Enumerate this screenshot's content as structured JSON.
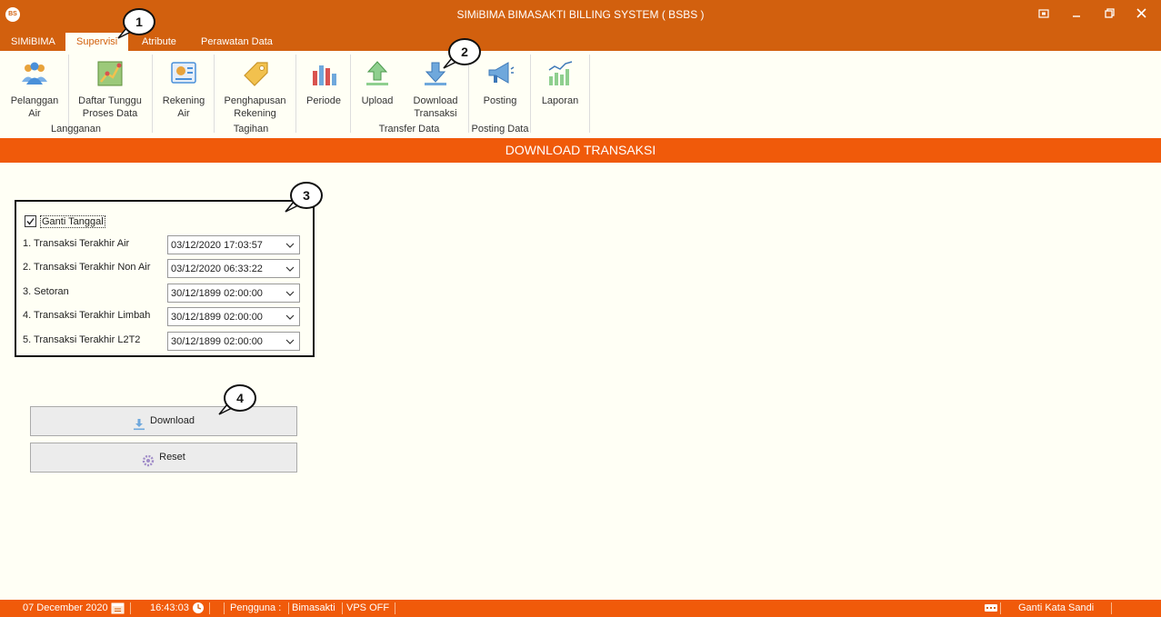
{
  "window": {
    "title": "SIMiBIMA BIMASAKTI BILLING SYSTEM ( BSBS )",
    "app_icon_text": "BS"
  },
  "tabs": [
    "SIMiBIMA",
    "Supervisi",
    "Atribute",
    "Perawatan Data"
  ],
  "ribbon": {
    "buttons": [
      {
        "label": "Pelanggan\nAir",
        "icon": "users-icon"
      },
      {
        "label": "Daftar Tunggu\nProses Data",
        "icon": "map-icon"
      },
      {
        "label": "Rekening\nAir",
        "icon": "bill-icon"
      },
      {
        "label": "Penghapusan\nRekening",
        "icon": "tag-icon"
      },
      {
        "label": "Periode",
        "icon": "bar-chart-icon"
      },
      {
        "label": "Upload",
        "icon": "upload-icon"
      },
      {
        "label": "Download\nTransaksi",
        "icon": "download-icon"
      },
      {
        "label": "Posting",
        "icon": "megaphone-icon"
      },
      {
        "label": "Laporan",
        "icon": "report-chart-icon"
      }
    ],
    "groups": [
      "Langganan",
      "Tagihan",
      "Transfer Data",
      "Posting Data"
    ]
  },
  "header_band": "DOWNLOAD TRANSAKSI",
  "form": {
    "checkbox_label": "Ganti Tanggal",
    "checkbox_checked": true,
    "rows": [
      {
        "label": "1. Transaksi Terakhir Air",
        "value": "03/12/2020 17:03:57"
      },
      {
        "label": "2. Transaksi Terakhir Non Air",
        "value": "03/12/2020 06:33:22"
      },
      {
        "label": "3. Setoran",
        "value": "30/12/1899 02:00:00"
      },
      {
        "label": "4. Transaksi Terakhir Limbah",
        "value": "30/12/1899 02:00:00"
      },
      {
        "label": "5. Transaksi Terakhir L2T2",
        "value": "30/12/1899 02:00:00"
      }
    ]
  },
  "buttons": {
    "download": "Download",
    "reset": "Reset"
  },
  "callouts": [
    "1",
    "2",
    "3",
    "4"
  ],
  "status": {
    "date": "07 December 2020",
    "time": "16:43:03",
    "user_label": "Pengguna :",
    "user": "Bimasakti",
    "vps": "VPS OFF",
    "change_password": "Ganti Kata Sandi"
  },
  "colors": {
    "titlebar": "#d2600e",
    "band": "#f05a0a",
    "background": "#fffff5"
  }
}
